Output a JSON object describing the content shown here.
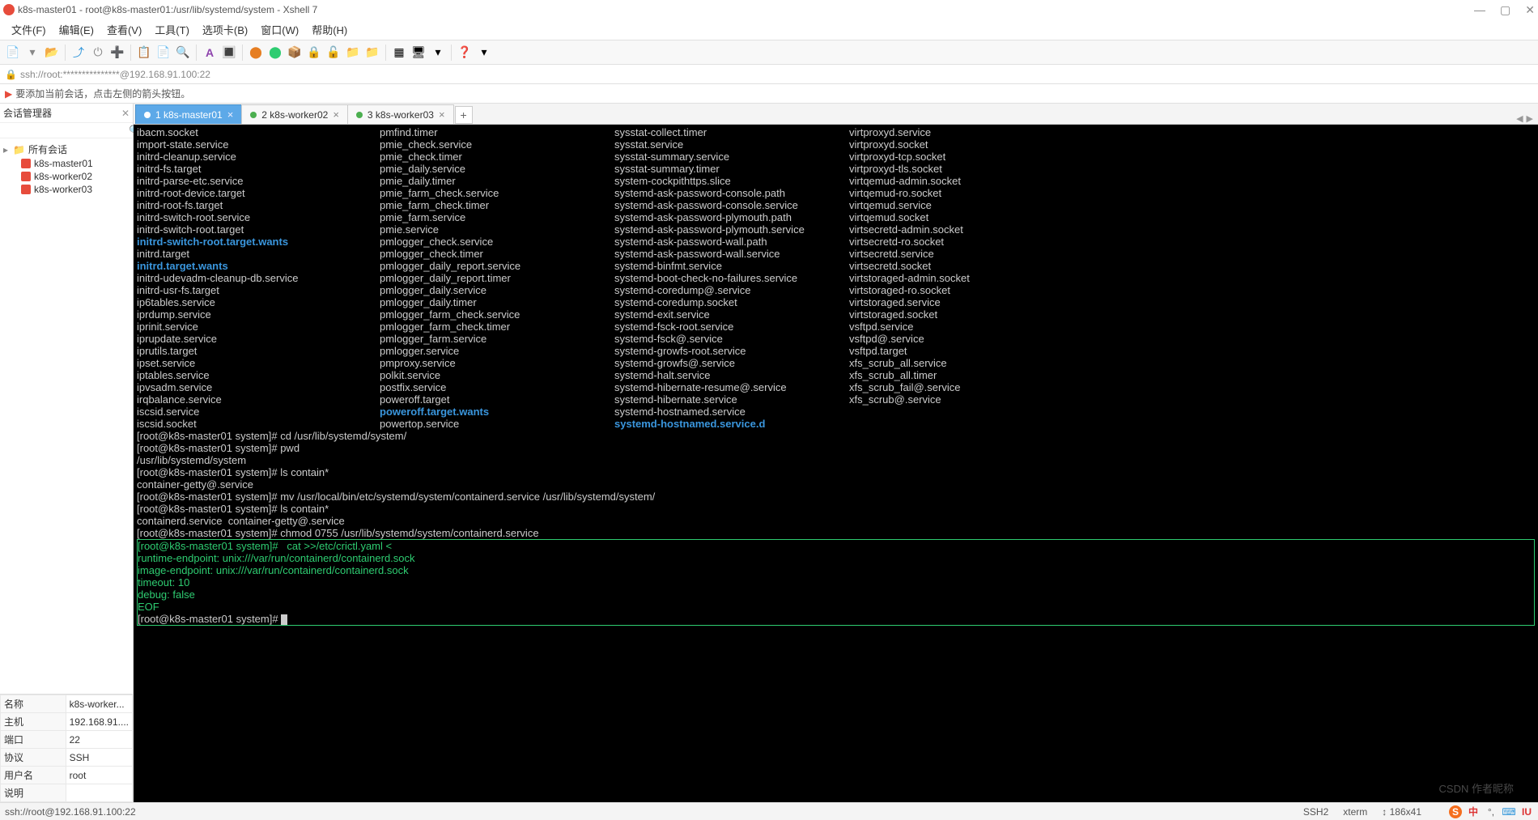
{
  "title": "k8s-master01 - root@k8s-master01:/usr/lib/systemd/system - Xshell 7",
  "menubar": [
    "文件(F)",
    "编辑(E)",
    "查看(V)",
    "工具(T)",
    "选项卡(B)",
    "窗口(W)",
    "帮助(H)"
  ],
  "address": "ssh://root:***************@192.168.91.100:22",
  "infobar": "要添加当前会话，点击左侧的箭头按钮。",
  "sidebar": {
    "title": "会话管理器",
    "root": "所有会话",
    "items": [
      "k8s-master01",
      "k8s-worker02",
      "k8s-worker03"
    ]
  },
  "props": [
    {
      "k": "名称",
      "v": "k8s-worker..."
    },
    {
      "k": "主机",
      "v": "192.168.91...."
    },
    {
      "k": "端口",
      "v": "22"
    },
    {
      "k": "协议",
      "v": "SSH"
    },
    {
      "k": "用户名",
      "v": "root"
    },
    {
      "k": "说明",
      "v": ""
    }
  ],
  "tabs": [
    {
      "label": "1 k8s-master01",
      "active": true
    },
    {
      "label": "2 k8s-worker02",
      "active": false
    },
    {
      "label": "3 k8s-worker03",
      "active": false
    }
  ],
  "ls": {
    "c1": [
      {
        "t": "ibacm.socket"
      },
      {
        "t": "import-state.service"
      },
      {
        "t": "initrd-cleanup.service"
      },
      {
        "t": "initrd-fs.target"
      },
      {
        "t": "initrd-parse-etc.service"
      },
      {
        "t": "initrd-root-device.target"
      },
      {
        "t": "initrd-root-fs.target"
      },
      {
        "t": "initrd-switch-root.service"
      },
      {
        "t": "initrd-switch-root.target"
      },
      {
        "t": "initrd-switch-root.target.wants",
        "d": true
      },
      {
        "t": "initrd.target"
      },
      {
        "t": "initrd.target.wants",
        "d": true
      },
      {
        "t": "initrd-udevadm-cleanup-db.service"
      },
      {
        "t": "initrd-usr-fs.target"
      },
      {
        "t": "ip6tables.service"
      },
      {
        "t": "iprdump.service"
      },
      {
        "t": "iprinit.service"
      },
      {
        "t": "iprupdate.service"
      },
      {
        "t": "iprutils.target"
      },
      {
        "t": "ipset.service"
      },
      {
        "t": "iptables.service"
      },
      {
        "t": "ipvsadm.service"
      },
      {
        "t": "irqbalance.service"
      },
      {
        "t": "iscsid.service"
      },
      {
        "t": "iscsid.socket"
      }
    ],
    "c2": [
      {
        "t": "pmfind.timer"
      },
      {
        "t": "pmie_check.service"
      },
      {
        "t": "pmie_check.timer"
      },
      {
        "t": "pmie_daily.service"
      },
      {
        "t": "pmie_daily.timer"
      },
      {
        "t": "pmie_farm_check.service"
      },
      {
        "t": "pmie_farm_check.timer"
      },
      {
        "t": "pmie_farm.service"
      },
      {
        "t": "pmie.service"
      },
      {
        "t": "pmlogger_check.service"
      },
      {
        "t": "pmlogger_check.timer"
      },
      {
        "t": "pmlogger_daily_report.service"
      },
      {
        "t": "pmlogger_daily_report.timer"
      },
      {
        "t": "pmlogger_daily.service"
      },
      {
        "t": "pmlogger_daily.timer"
      },
      {
        "t": "pmlogger_farm_check.service"
      },
      {
        "t": "pmlogger_farm_check.timer"
      },
      {
        "t": "pmlogger_farm.service"
      },
      {
        "t": "pmlogger.service"
      },
      {
        "t": "pmproxy.service"
      },
      {
        "t": "polkit.service"
      },
      {
        "t": "postfix.service"
      },
      {
        "t": "poweroff.target"
      },
      {
        "t": "poweroff.target.wants",
        "d": true
      },
      {
        "t": "powertop.service"
      }
    ],
    "c3": [
      {
        "t": "sysstat-collect.timer"
      },
      {
        "t": "sysstat.service"
      },
      {
        "t": "sysstat-summary.service"
      },
      {
        "t": "sysstat-summary.timer"
      },
      {
        "t": "system-cockpithttps.slice"
      },
      {
        "t": "systemd-ask-password-console.path"
      },
      {
        "t": "systemd-ask-password-console.service"
      },
      {
        "t": "systemd-ask-password-plymouth.path"
      },
      {
        "t": "systemd-ask-password-plymouth.service"
      },
      {
        "t": "systemd-ask-password-wall.path"
      },
      {
        "t": "systemd-ask-password-wall.service"
      },
      {
        "t": "systemd-binfmt.service"
      },
      {
        "t": "systemd-boot-check-no-failures.service"
      },
      {
        "t": "systemd-coredump@.service"
      },
      {
        "t": "systemd-coredump.socket"
      },
      {
        "t": "systemd-exit.service"
      },
      {
        "t": "systemd-fsck-root.service"
      },
      {
        "t": "systemd-fsck@.service"
      },
      {
        "t": "systemd-growfs-root.service"
      },
      {
        "t": "systemd-growfs@.service"
      },
      {
        "t": "systemd-halt.service"
      },
      {
        "t": "systemd-hibernate-resume@.service"
      },
      {
        "t": "systemd-hibernate.service"
      },
      {
        "t": "systemd-hostnamed.service"
      },
      {
        "t": "systemd-hostnamed.service.d",
        "d": true
      }
    ],
    "c4": [
      {
        "t": "virtproxyd.service"
      },
      {
        "t": "virtproxyd.socket"
      },
      {
        "t": "virtproxyd-tcp.socket"
      },
      {
        "t": "virtproxyd-tls.socket"
      },
      {
        "t": "virtqemud-admin.socket"
      },
      {
        "t": "virtqemud-ro.socket"
      },
      {
        "t": "virtqemud.service"
      },
      {
        "t": "virtqemud.socket"
      },
      {
        "t": "virtsecretd-admin.socket"
      },
      {
        "t": "virtsecretd-ro.socket"
      },
      {
        "t": "virtsecretd.service"
      },
      {
        "t": "virtsecretd.socket"
      },
      {
        "t": "virtstoraged-admin.socket"
      },
      {
        "t": "virtstoraged-ro.socket"
      },
      {
        "t": "virtstoraged.service"
      },
      {
        "t": "virtstoraged.socket"
      },
      {
        "t": "vsftpd.service"
      },
      {
        "t": "vsftpd@.service"
      },
      {
        "t": "vsftpd.target"
      },
      {
        "t": "xfs_scrub_all.service"
      },
      {
        "t": "xfs_scrub_all.timer"
      },
      {
        "t": "xfs_scrub_fail@.service"
      },
      {
        "t": "xfs_scrub@.service"
      }
    ]
  },
  "cmdlines": [
    "[root@k8s-master01 system]# cd /usr/lib/systemd/system/",
    "[root@k8s-master01 system]# pwd",
    "/usr/lib/systemd/system",
    "[root@k8s-master01 system]# ls contain*",
    "container-getty@.service",
    "[root@k8s-master01 system]# mv /usr/local/bin/etc/systemd/system/containerd.service /usr/lib/systemd/system/",
    "[root@k8s-master01 system]# ls contain*",
    "containerd.service  container-getty@.service",
    "[root@k8s-master01 system]# chmod 0755 /usr/lib/systemd/system/containerd.service"
  ],
  "highlight": [
    "[root@k8s-master01 system]#   cat >>/etc/crictl.yaml <<EOF",
    "runtime-endpoint: unix:///var/run/containerd/containerd.sock",
    "image-endpoint: unix:///var/run/containerd/containerd.sock",
    "timeout: 10",
    "debug: false",
    "EOF"
  ],
  "final_prompt": "[root@k8s-master01 system]# ",
  "status": {
    "left": "ssh://root@192.168.91.100:22",
    "ssh": "SSH2",
    "term": "xterm",
    "size": "186x41",
    "ime": "中",
    "iu": "IU"
  },
  "watermark": "CSDN 作者昵称"
}
